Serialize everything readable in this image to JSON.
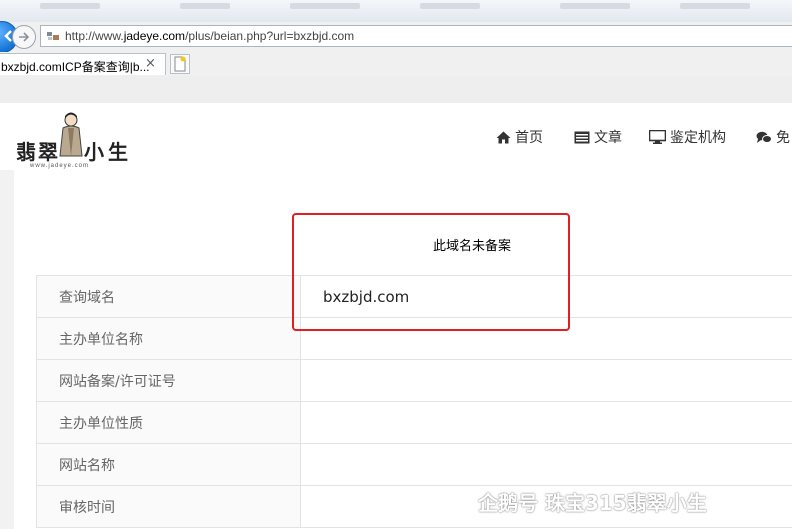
{
  "browser": {
    "url_prefix": "http://www.",
    "url_host": "jadeye.com",
    "url_path": "/plus/beian.php?url=bxzbjd.com",
    "tab_title": "bxzbjd.comICP备案查询|b...",
    "tab_close": "×"
  },
  "site": {
    "logo_text_left": "翡翠",
    "logo_text_right": "小生",
    "logo_url": "www.jadeye.com",
    "nav": [
      {
        "label": "首页",
        "icon": "home-icon"
      },
      {
        "label": "文章",
        "icon": "list-icon"
      },
      {
        "label": "鉴定机构",
        "icon": "monitor-icon"
      },
      {
        "label": "免",
        "icon": "chat-icon"
      }
    ]
  },
  "query": {
    "notice": "此域名未备案",
    "rows": [
      {
        "label": "查询域名",
        "value": "bxzbjd.com"
      },
      {
        "label": "主办单位名称",
        "value": ""
      },
      {
        "label": "网站备案/许可证号",
        "value": ""
      },
      {
        "label": "主办单位性质",
        "value": ""
      },
      {
        "label": "网站名称",
        "value": ""
      },
      {
        "label": "审核时间",
        "value": ""
      }
    ]
  },
  "watermark": {
    "text": "企鹅号 珠宝315翡翠小生"
  },
  "colors": {
    "highlight_border": "#e02020",
    "browser_accent": "#1573d6"
  }
}
